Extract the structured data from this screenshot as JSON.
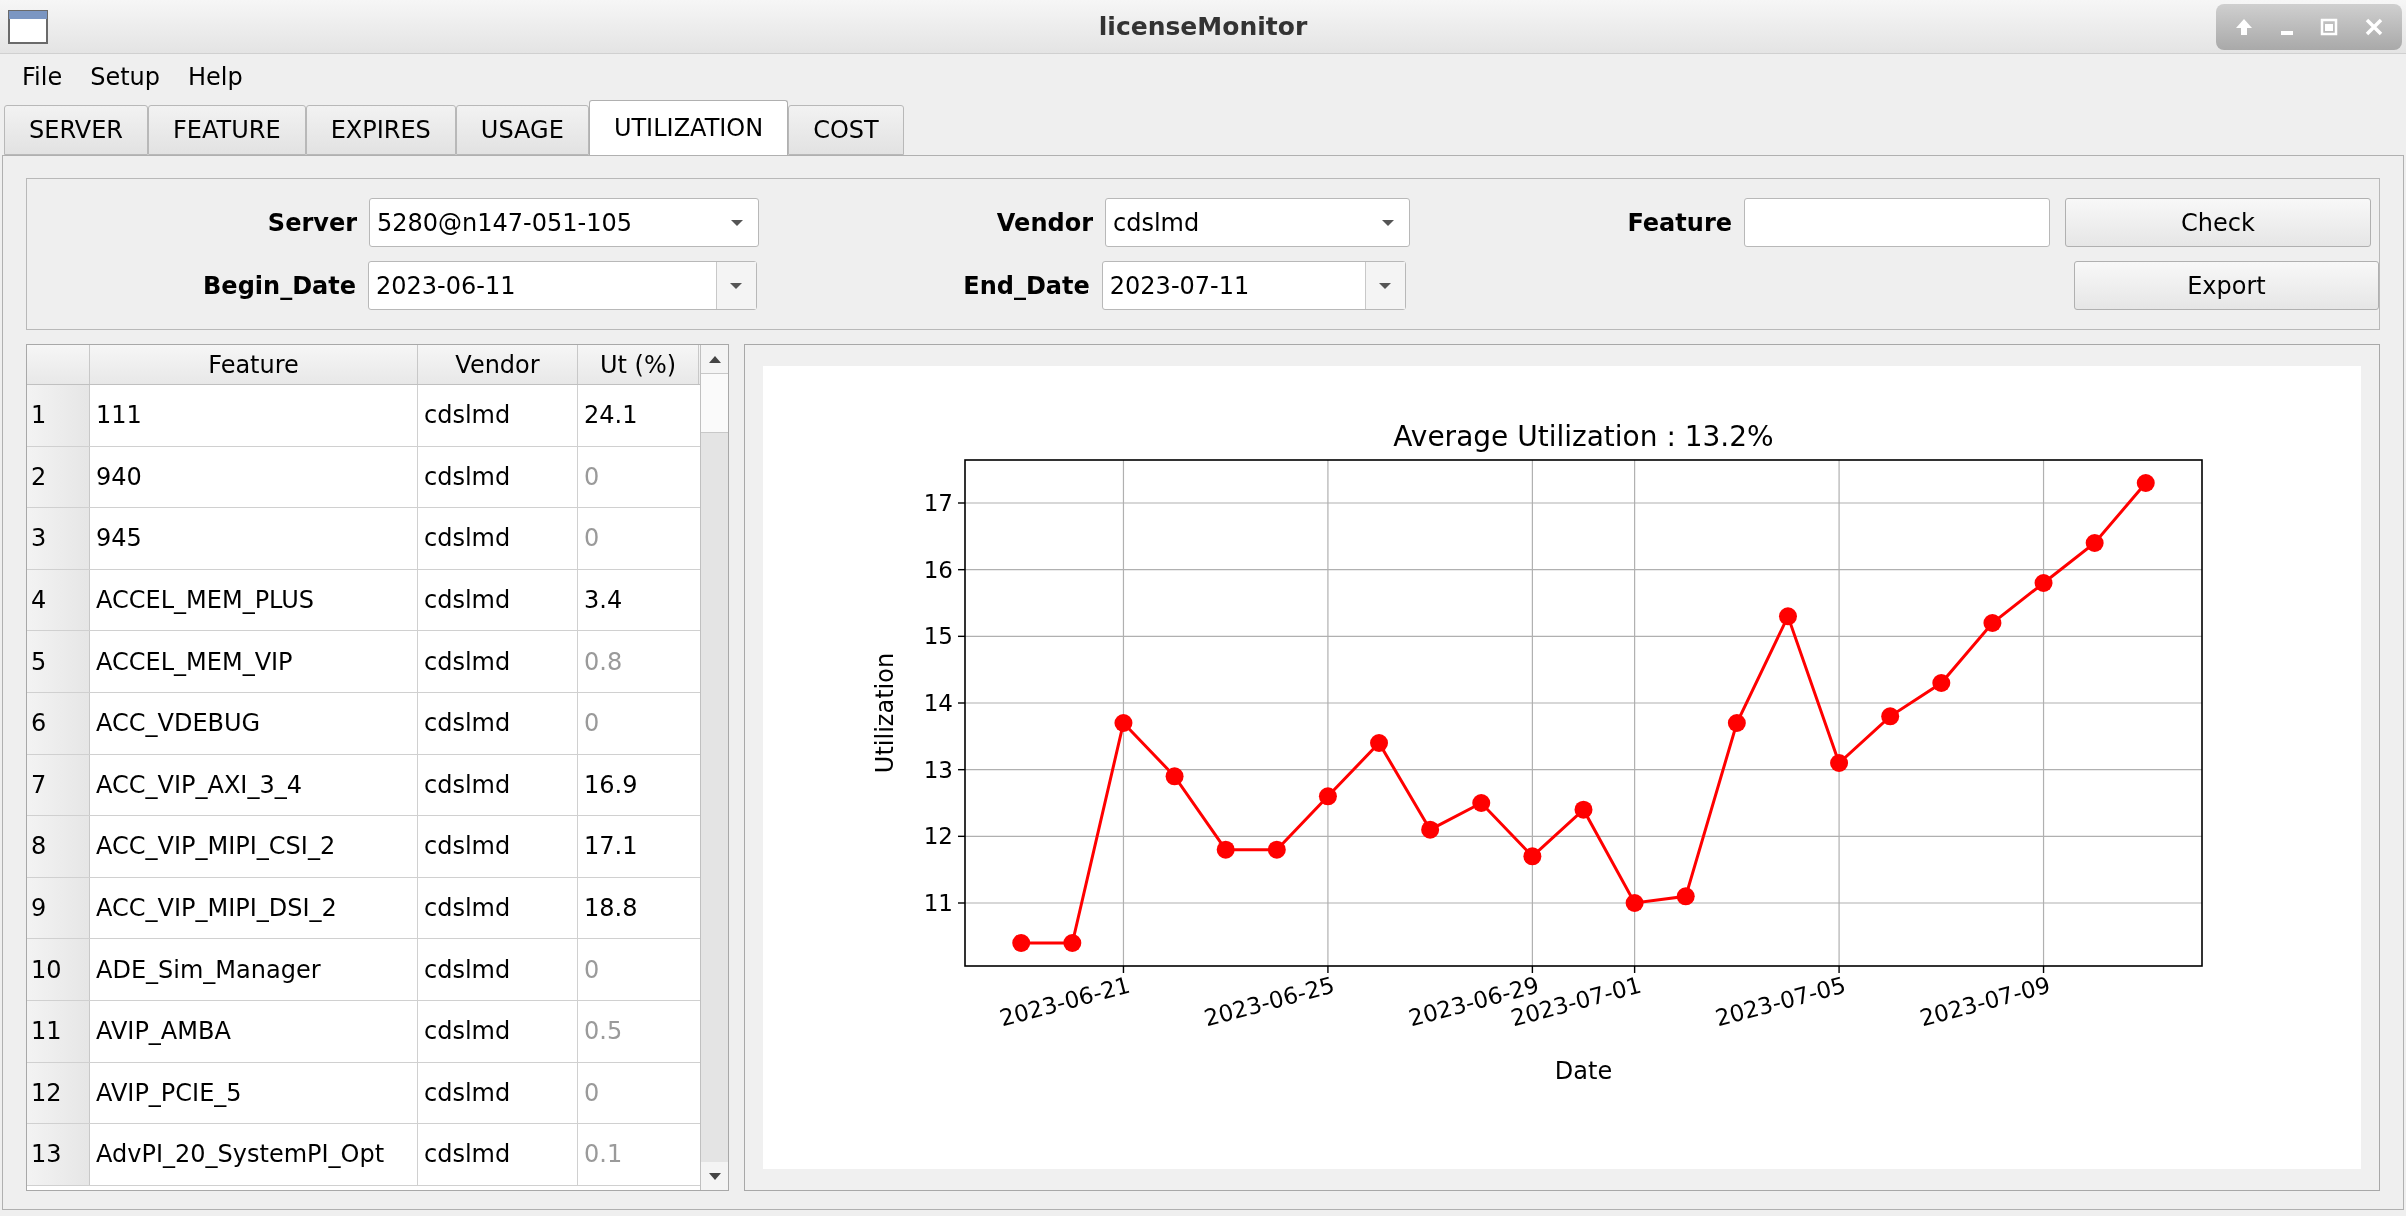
{
  "window": {
    "title": "licenseMonitor"
  },
  "menu": [
    "File",
    "Setup",
    "Help"
  ],
  "tabs": [
    {
      "label": "SERVER",
      "selected": false
    },
    {
      "label": "FEATURE",
      "selected": false
    },
    {
      "label": "EXPIRES",
      "selected": false
    },
    {
      "label": "USAGE",
      "selected": false
    },
    {
      "label": "UTILIZATION",
      "selected": true
    },
    {
      "label": "COST",
      "selected": false
    }
  ],
  "filters": {
    "server": {
      "label": "Server",
      "value": "5280@n147-051-105"
    },
    "begin_date": {
      "label": "Begin_Date",
      "value": "2023-06-11"
    },
    "vendor": {
      "label": "Vendor",
      "value": "cdslmd"
    },
    "end_date": {
      "label": "End_Date",
      "value": "2023-07-11"
    },
    "feature": {
      "label": "Feature"
    },
    "buttons": [
      "Check",
      "Export"
    ]
  },
  "table": {
    "columns": [
      "Feature",
      "Vendor",
      "Ut (%)"
    ],
    "rows": [
      {
        "index": "1",
        "feature": "111",
        "vendor": "cdslmd",
        "ut": "24.1",
        "dimmed": false
      },
      {
        "index": "2",
        "feature": "940",
        "vendor": "cdslmd",
        "ut": "0",
        "dimmed": true
      },
      {
        "index": "3",
        "feature": "945",
        "vendor": "cdslmd",
        "ut": "0",
        "dimmed": true
      },
      {
        "index": "4",
        "feature": "ACCEL_MEM_PLUS",
        "vendor": "cdslmd",
        "ut": "3.4",
        "dimmed": false
      },
      {
        "index": "5",
        "feature": "ACCEL_MEM_VIP",
        "vendor": "cdslmd",
        "ut": "0.8",
        "dimmed": true
      },
      {
        "index": "6",
        "feature": "ACC_VDEBUG",
        "vendor": "cdslmd",
        "ut": "0",
        "dimmed": true
      },
      {
        "index": "7",
        "feature": "ACC_VIP_AXI_3_4",
        "vendor": "cdslmd",
        "ut": "16.9",
        "dimmed": false
      },
      {
        "index": "8",
        "feature": "ACC_VIP_MIPI_CSI_2",
        "vendor": "cdslmd",
        "ut": "17.1",
        "dimmed": false
      },
      {
        "index": "9",
        "feature": "ACC_VIP_MIPI_DSI_2",
        "vendor": "cdslmd",
        "ut": "18.8",
        "dimmed": false
      },
      {
        "index": "10",
        "feature": "ADE_Sim_Manager",
        "vendor": "cdslmd",
        "ut": "0",
        "dimmed": true
      },
      {
        "index": "11",
        "feature": "AVIP_AMBA",
        "vendor": "cdslmd",
        "ut": "0.5",
        "dimmed": true
      },
      {
        "index": "12",
        "feature": "AVIP_PCIE_5",
        "vendor": "cdslmd",
        "ut": "0",
        "dimmed": true
      },
      {
        "index": "13",
        "feature": "AdvPI_20_SystemPI_Opt",
        "vendor": "cdslmd",
        "ut": "0.1",
        "dimmed": true
      }
    ]
  },
  "chart": {
    "chart_data": {
      "type": "line",
      "title": "Average Utilization : 13.2%",
      "xlabel": "Date",
      "ylabel": "Utilization",
      "x": [
        "2023-06-19",
        "2023-06-20",
        "2023-06-21",
        "2023-06-22",
        "2023-06-23",
        "2023-06-24",
        "2023-06-25",
        "2023-06-26",
        "2023-06-27",
        "2023-06-28",
        "2023-06-29",
        "2023-06-30",
        "2023-07-01",
        "2023-07-02",
        "2023-07-03",
        "2023-07-04",
        "2023-07-05",
        "2023-07-06",
        "2023-07-07",
        "2023-07-08",
        "2023-07-09",
        "2023-07-10",
        "2023-07-11"
      ],
      "series": [
        {
          "color": "#ff0000",
          "marker": "o",
          "values": [
            10.4,
            10.4,
            13.7,
            12.9,
            11.8,
            11.8,
            12.6,
            13.4,
            12.1,
            12.5,
            11.7,
            12.4,
            11.0,
            11.1,
            13.7,
            15.3,
            13.1,
            13.8,
            14.3,
            15.2,
            15.8,
            16.4,
            17.3
          ]
        }
      ],
      "xlim": [
        "2023-06-17T21:36",
        "2023-07-12T02:24"
      ],
      "ylim": [
        10.055,
        17.645
      ],
      "grid": true,
      "xticks": [
        "2023-06-21",
        "2023-06-25",
        "2023-06-29",
        "2023-07-01",
        "2023-07-05",
        "2023-07-09"
      ],
      "yticks": [
        11,
        12,
        13,
        14,
        15,
        16,
        17
      ]
    }
  }
}
